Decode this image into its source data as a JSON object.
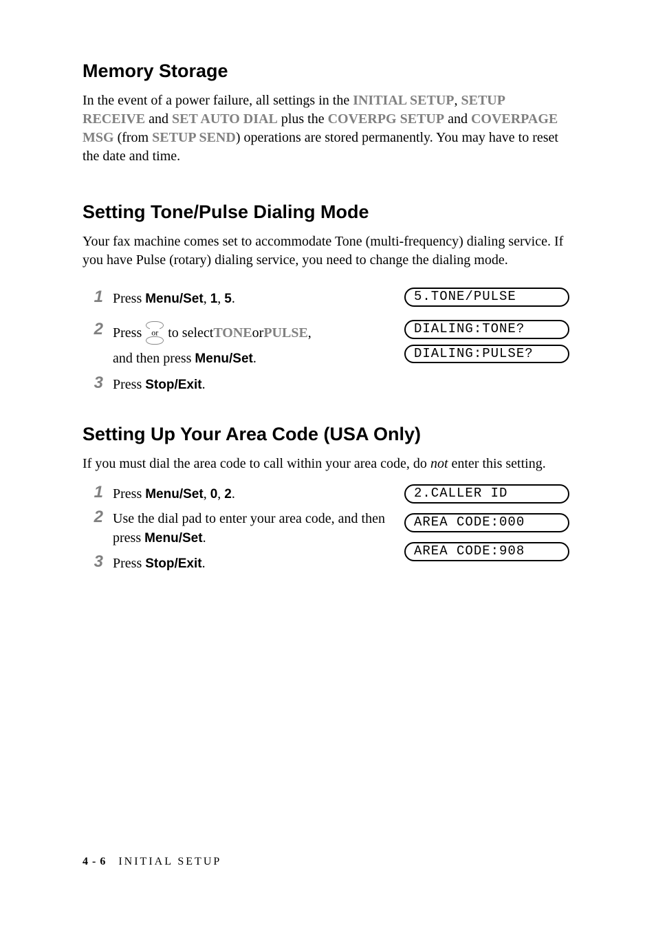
{
  "sections": {
    "memory": {
      "title": "Memory Storage",
      "p_before1": "In the event of a power failure, all settings in the ",
      "kw1": "INITIAL SETUP",
      "p_before2": ", ",
      "kw2": "SETUP RECEIVE",
      "p_before3": " and ",
      "kw3": "SET AUTO DIAL",
      "p_before4": " plus the ",
      "kw4": "COVERPG SETUP",
      "p_before5": " and ",
      "kw5": "COVERPAGE MSG",
      "p_before6": " (from ",
      "kw6": "SETUP SEND",
      "p_after": ") operations are stored permanently. You may have to reset the date and time."
    },
    "tonepulse": {
      "title": "Setting Tone/Pulse Dialing Mode",
      "intro": "Your fax machine comes set to accommodate Tone (multi-frequency) dialing service. If you have Pulse (rotary) dialing service, you need to change the dialing mode.",
      "steps": {
        "s1_num": "1",
        "s1_a": "Press ",
        "s1_b": "Menu/Set",
        "s1_c": ", ",
        "s1_d": "1",
        "s1_e": ", ",
        "s1_f": "5",
        "s1_g": ".",
        "s2_num": "2",
        "s2_a": "Press ",
        "s2_or": "or",
        "s2_b": " to select ",
        "s2_c": "TONE",
        "s2_d": " or ",
        "s2_e": "PULSE",
        "s2_f": ",",
        "s2_g": "and then press ",
        "s2_h": "Menu/Set",
        "s2_i": ".",
        "s3_num": "3",
        "s3_a": "Press ",
        "s3_b": "Stop/Exit",
        "s3_c": "."
      },
      "lcds": {
        "l1": "5.TONE/PULSE",
        "l2": "DIALING:TONE?",
        "l3": "DIALING:PULSE?"
      }
    },
    "areacode": {
      "title": "Setting Up Your Area Code (USA Only)",
      "intro_a": "If you must dial the area code to call within your area code, do ",
      "intro_not": "not",
      "intro_b": " enter this setting.",
      "steps": {
        "s1_num": "1",
        "s1_a": "Press ",
        "s1_b": "Menu/Set",
        "s1_c": ", ",
        "s1_d": "0",
        "s1_e": ", ",
        "s1_f": "2",
        "s1_g": ".",
        "s2_num": "2",
        "s2_a": "Use the dial pad to enter your area code, and then press ",
        "s2_b": "Menu/Set",
        "s2_c": ".",
        "s3_num": "3",
        "s3_a": "Press ",
        "s3_b": "Stop/Exit",
        "s3_c": "."
      },
      "lcds": {
        "l1": "2.CALLER ID",
        "l2": "AREA CODE:000",
        "l3": "AREA CODE:908"
      }
    }
  },
  "footer": {
    "page": "4 - 6",
    "chapter": "INITIAL SETUP"
  }
}
